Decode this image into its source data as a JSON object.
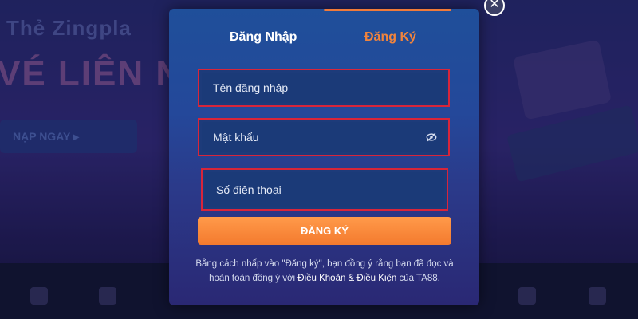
{
  "background": {
    "hero_line1": "Thẻ Zingpla",
    "hero_line2": "VÉ LIÊN N",
    "cta_label": "NẠP NGAY ▸"
  },
  "modal": {
    "tabs": [
      {
        "label": "Đăng Nhập",
        "active": false
      },
      {
        "label": "Đăng Ký",
        "active": true
      }
    ],
    "fields": {
      "username_placeholder": "Tên đăng nhập",
      "password_placeholder": "Mật khẩu",
      "phone_placeholder": "Số điện thoại"
    },
    "submit_label": "ĐĂNG KÝ",
    "terms": {
      "prefix": "Bằng cách nhấp vào \"Đăng ký\", bạn đồng ý rằng bạn đã đọc và hoàn toàn đồng ý với ",
      "link": "Điều Khoản & Điều Kiện",
      "suffix": " của TA88."
    }
  },
  "close_symbol": "✕",
  "colors": {
    "accent": "#f2843c",
    "highlight_border": "#d8253a",
    "modal_bg": "#24489a"
  }
}
